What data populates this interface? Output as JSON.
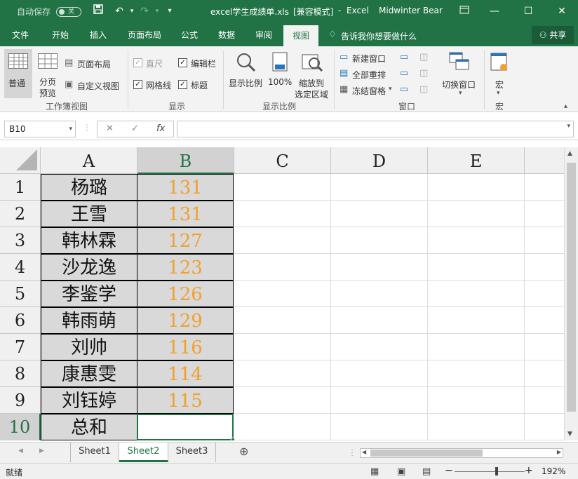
{
  "titlebar": {
    "autosave_label": "自动保存",
    "autosave_state": "关",
    "filename": "excel学生成绩单.xls",
    "mode": "[兼容模式]",
    "separator": "-",
    "app": "Excel",
    "user": "Midwinter Bear"
  },
  "tabs": [
    "文件",
    "开始",
    "插入",
    "页面布局",
    "公式",
    "数据",
    "审阅",
    "视图"
  ],
  "active_tab": "视图",
  "tell_me": "告诉我你想要做什么",
  "share": "共享",
  "ribbon": {
    "view_group": {
      "normal": "普通",
      "page_break_1": "分页",
      "page_break_2": "预览",
      "page_layout": "页面布局",
      "custom_views": "自定义视图",
      "label": "工作簿视图"
    },
    "show_group": {
      "ruler": "直尺",
      "formula_bar": "编辑栏",
      "gridlines": "网格线",
      "headings": "标题",
      "label": "显示"
    },
    "zoom_group": {
      "zoom": "显示比例",
      "zoom100": "100%",
      "zoom_sel_1": "缩放到",
      "zoom_sel_2": "选定区域",
      "label": "显示比例"
    },
    "window_group": {
      "new_window": "新建窗口",
      "arrange_all": "全部重排",
      "freeze": "冻结窗格",
      "switch": "切换窗口",
      "label": "窗口"
    },
    "macro_group": {
      "macros": "宏",
      "label": "宏"
    }
  },
  "formula": {
    "namebox": "B10",
    "fx": "fx",
    "value": ""
  },
  "columns": [
    "A",
    "B",
    "C",
    "D",
    "E"
  ],
  "rows": [
    {
      "num": "1",
      "name": "杨璐",
      "score": "131"
    },
    {
      "num": "2",
      "name": "王雪",
      "score": "131"
    },
    {
      "num": "3",
      "name": "韩林霖",
      "score": "127"
    },
    {
      "num": "4",
      "name": "沙龙逸",
      "score": "123"
    },
    {
      "num": "5",
      "name": "李鉴学",
      "score": "126"
    },
    {
      "num": "6",
      "name": "韩雨萌",
      "score": "129"
    },
    {
      "num": "7",
      "name": "刘帅",
      "score": "116"
    },
    {
      "num": "8",
      "name": "康惠雯",
      "score": "114"
    },
    {
      "num": "9",
      "name": "刘钰婷",
      "score": "115"
    },
    {
      "num": "10",
      "name": "总和",
      "score": ""
    }
  ],
  "sheets": [
    "Sheet1",
    "Sheet2",
    "Sheet3"
  ],
  "active_sheet": "Sheet2",
  "status": {
    "ready": "就绪",
    "zoom": "192%"
  },
  "colors": {
    "brand": "#217346",
    "score_text": "#f0a030",
    "cell_fill": "#d9d9d9"
  }
}
